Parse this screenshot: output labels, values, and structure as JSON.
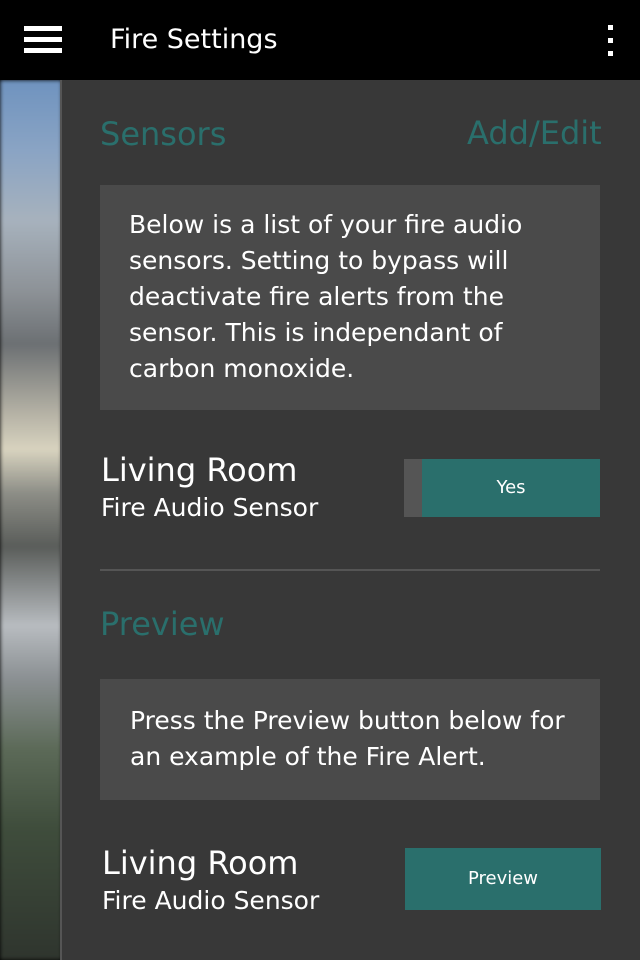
{
  "app_bar": {
    "title": "Fire Settings",
    "menu_icon": "hamburger-menu-icon",
    "overflow_icon": "more-vertical-icon"
  },
  "sensors_section": {
    "title": "Sensors",
    "action_label": "Add/Edit",
    "description": "Below is a list of your fire audio sensors. Setting to bypass will deactivate fire alerts from the sensor. This is independant of carbon monoxide.",
    "sensor": {
      "name": "Living Room",
      "type": "Fire Audio Sensor",
      "toggle_label": "Yes"
    }
  },
  "preview_section": {
    "title": "Preview",
    "description": "Press the Preview button below for an example of the Fire Alert.",
    "sensor": {
      "name": "Living Room",
      "type": "Fire Audio Sensor",
      "button_label": "Preview"
    }
  },
  "colors": {
    "accent": "#2a6f6c",
    "panel_background": "#383838",
    "box_background": "#4a4a4a",
    "app_bar_background": "#000000"
  }
}
